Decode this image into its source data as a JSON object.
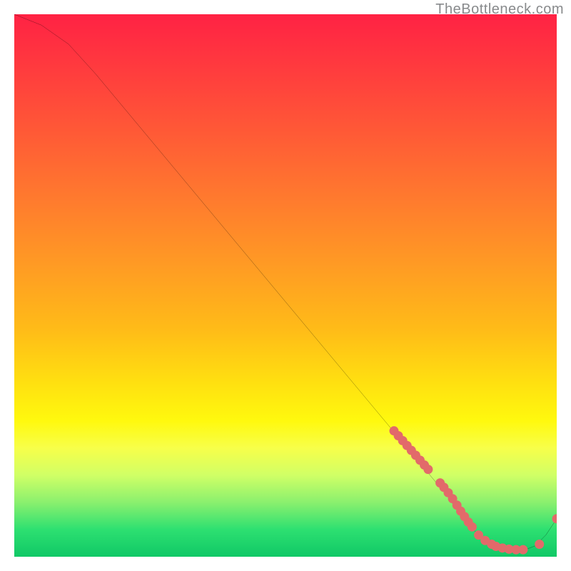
{
  "watermark": "TheBottleneck.com",
  "chart_data": {
    "type": "line",
    "title": "",
    "xlabel": "",
    "ylabel": "",
    "xlim": [
      0,
      100
    ],
    "ylim": [
      0,
      100
    ],
    "grid": false,
    "legend": false,
    "series": [
      {
        "name": "bottleneck-curve",
        "x": [
          0,
          5,
          10,
          15,
          20,
          25,
          30,
          35,
          40,
          45,
          50,
          55,
          60,
          65,
          70,
          72,
          74,
          76,
          78,
          80,
          82,
          84,
          86,
          88,
          90,
          92,
          94,
          96,
          98,
          100
        ],
        "y": [
          100,
          98,
          94.5,
          89,
          83,
          77,
          71,
          65,
          59,
          53,
          47,
          41,
          35,
          29,
          23,
          20.6,
          18.2,
          15.8,
          13.4,
          11,
          8,
          5.5,
          3.8,
          2.5,
          1.8,
          1.4,
          1.2,
          2.0,
          4.0,
          7.0
        ],
        "color": "#000000"
      }
    ],
    "markers": [
      {
        "name": "upper-cluster",
        "color": "#e26a6a",
        "r": 6.5,
        "points": [
          [
            70,
            23.2
          ],
          [
            70.8,
            22.3
          ],
          [
            71.6,
            21.4
          ],
          [
            72.4,
            20.5
          ],
          [
            73.2,
            19.6
          ],
          [
            74.0,
            18.7
          ],
          [
            74.8,
            17.8
          ],
          [
            75.6,
            16.9
          ],
          [
            76.3,
            16.1
          ],
          [
            78.5,
            13.6
          ],
          [
            79.2,
            12.8
          ],
          [
            80.0,
            11.8
          ],
          [
            80.8,
            10.7
          ],
          [
            81.6,
            9.5
          ],
          [
            82.3,
            8.4
          ],
          [
            83.0,
            7.4
          ],
          [
            83.7,
            6.4
          ],
          [
            84.4,
            5.5
          ]
        ]
      },
      {
        "name": "floor-cluster",
        "color": "#e26a6a",
        "r": 6.5,
        "points": [
          [
            85.6,
            4.0
          ],
          [
            86.8,
            3.0
          ],
          [
            88.0,
            2.3
          ],
          [
            88.8,
            1.9
          ],
          [
            90.0,
            1.6
          ],
          [
            91.2,
            1.4
          ],
          [
            92.5,
            1.3
          ],
          [
            93.8,
            1.3
          ],
          [
            96.8,
            2.3
          ]
        ]
      },
      {
        "name": "tail-point",
        "color": "#e26a6a",
        "r": 6.5,
        "points": [
          [
            100,
            7.0
          ]
        ]
      }
    ],
    "background_gradient": {
      "stops": [
        {
          "pos": 0,
          "color": "#ff2244"
        },
        {
          "pos": 25,
          "color": "#ff6a32"
        },
        {
          "pos": 50,
          "color": "#ffb41a"
        },
        {
          "pos": 70,
          "color": "#fff010"
        },
        {
          "pos": 85,
          "color": "#c0ff60"
        },
        {
          "pos": 100,
          "color": "#10c866"
        }
      ]
    }
  }
}
